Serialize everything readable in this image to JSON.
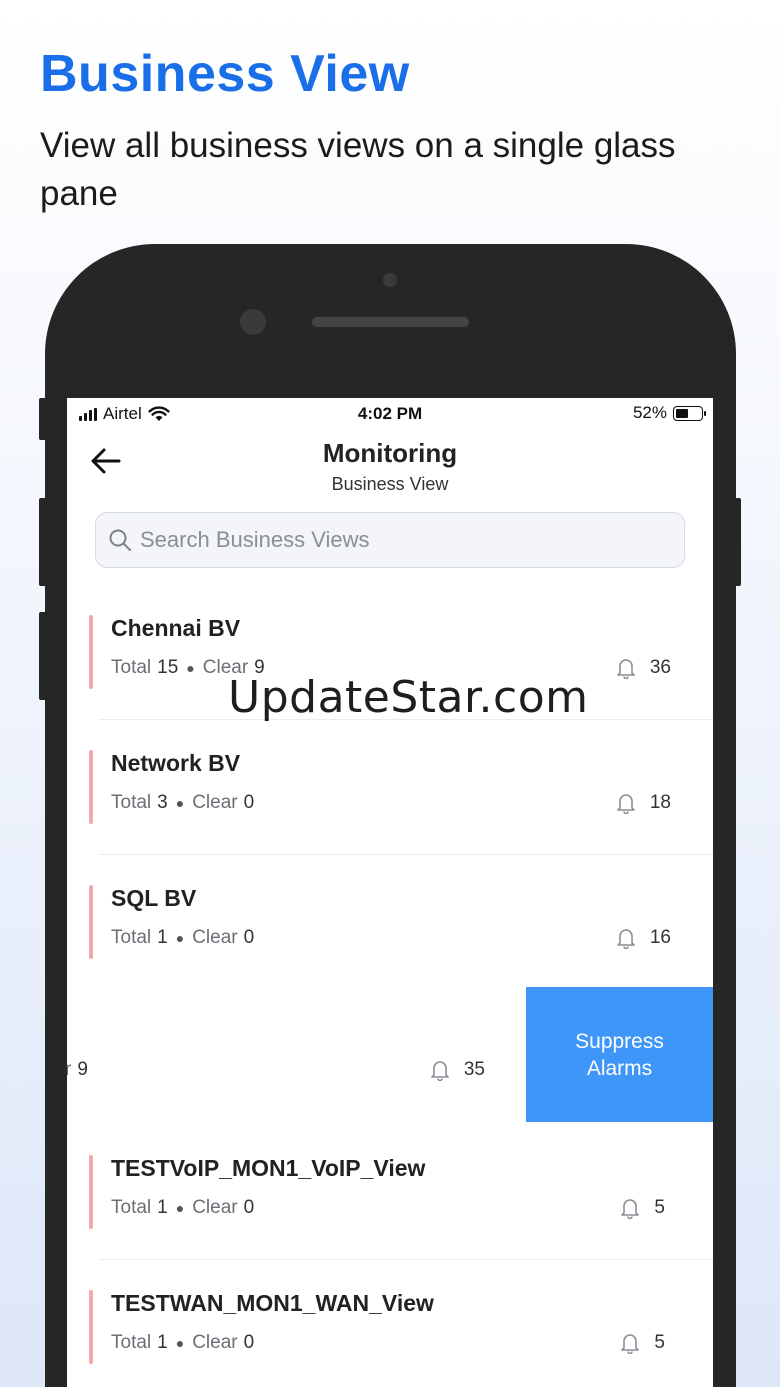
{
  "promo": {
    "headline": "Business View",
    "subline": "View all business views on a single glass pane"
  },
  "status_bar": {
    "carrier": "Airtel",
    "time": "4:02 PM",
    "battery": "52%",
    "battery_level": 0.52
  },
  "nav": {
    "title": "Monitoring",
    "subtitle": "Business View"
  },
  "search": {
    "placeholder": "Search Business Views"
  },
  "list": {
    "total_label": "Total",
    "clear_label": "Clear",
    "items": [
      {
        "name": "Chennai BV",
        "total": "15",
        "clear": "9",
        "alarms": "36"
      },
      {
        "name": "Network BV",
        "total": "3",
        "clear": "0",
        "alarms": "18"
      },
      {
        "name": "SQL BV",
        "total": "1",
        "clear": "0",
        "alarms": "16"
      },
      {
        "name": "",
        "total": "",
        "clear": "9",
        "clear_partial": "r",
        "alarms": "35"
      },
      {
        "name": "TESTVoIP_MON1_VoIP_View",
        "total": "1",
        "clear": "0",
        "alarms": "5"
      },
      {
        "name": "TESTWAN_MON1_WAN_View",
        "total": "1",
        "clear": "0",
        "alarms": "5"
      }
    ],
    "swipe_action": "Suppress Alarms"
  },
  "watermark": "UpdateStar.com",
  "colors": {
    "headline": "#1a6fe8",
    "accent_bar": "#f3a9a9",
    "suppress_bg": "#3e96f8",
    "phone_body": "#262626"
  }
}
